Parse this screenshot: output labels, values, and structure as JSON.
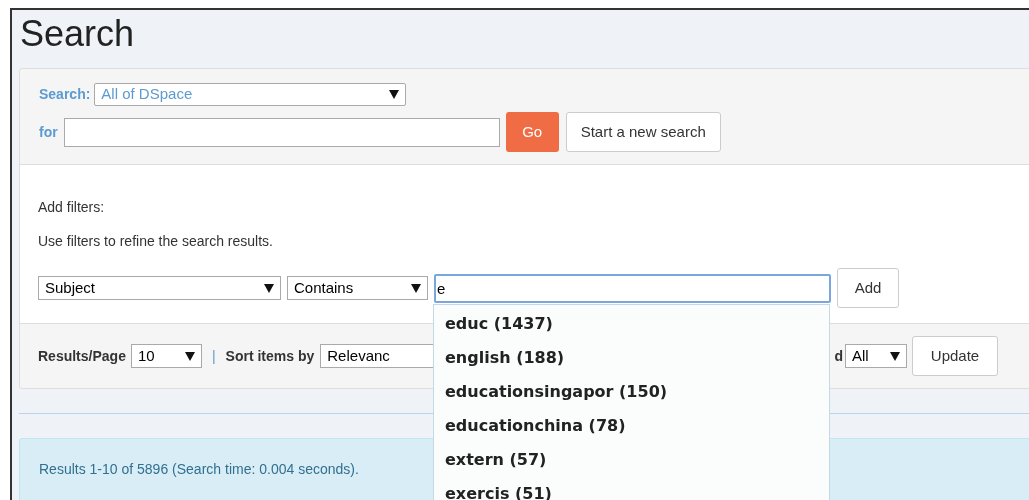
{
  "title": "Search",
  "scope": {
    "label": "Search:",
    "value": "All of DSpace"
  },
  "query": {
    "label": "for"
  },
  "buttons": {
    "go": "Go",
    "new_search": "Start a new search"
  },
  "filters": {
    "heading": "Add filters:",
    "hint": "Use filters to refine the search results.",
    "field": "Subject",
    "operator": "Contains",
    "value": "e",
    "add": "Add",
    "suggestions": [
      {
        "label": "educ (1437)"
      },
      {
        "label": "english (188)"
      },
      {
        "label": "educationsingapor (150)"
      },
      {
        "label": "educationchina (78)"
      },
      {
        "label": "extern (57)"
      },
      {
        "label": "exercis (51)"
      }
    ]
  },
  "controls": {
    "rpp_label": "Results/Page",
    "rpp": "10",
    "separator": "|",
    "sort_label": "Sort items by",
    "sort": "Relevanc",
    "filter_label": "d",
    "filter": "All",
    "update": "Update"
  },
  "results": "Results 1-10 of 5896 (Search time: 0.004 seconds)."
}
